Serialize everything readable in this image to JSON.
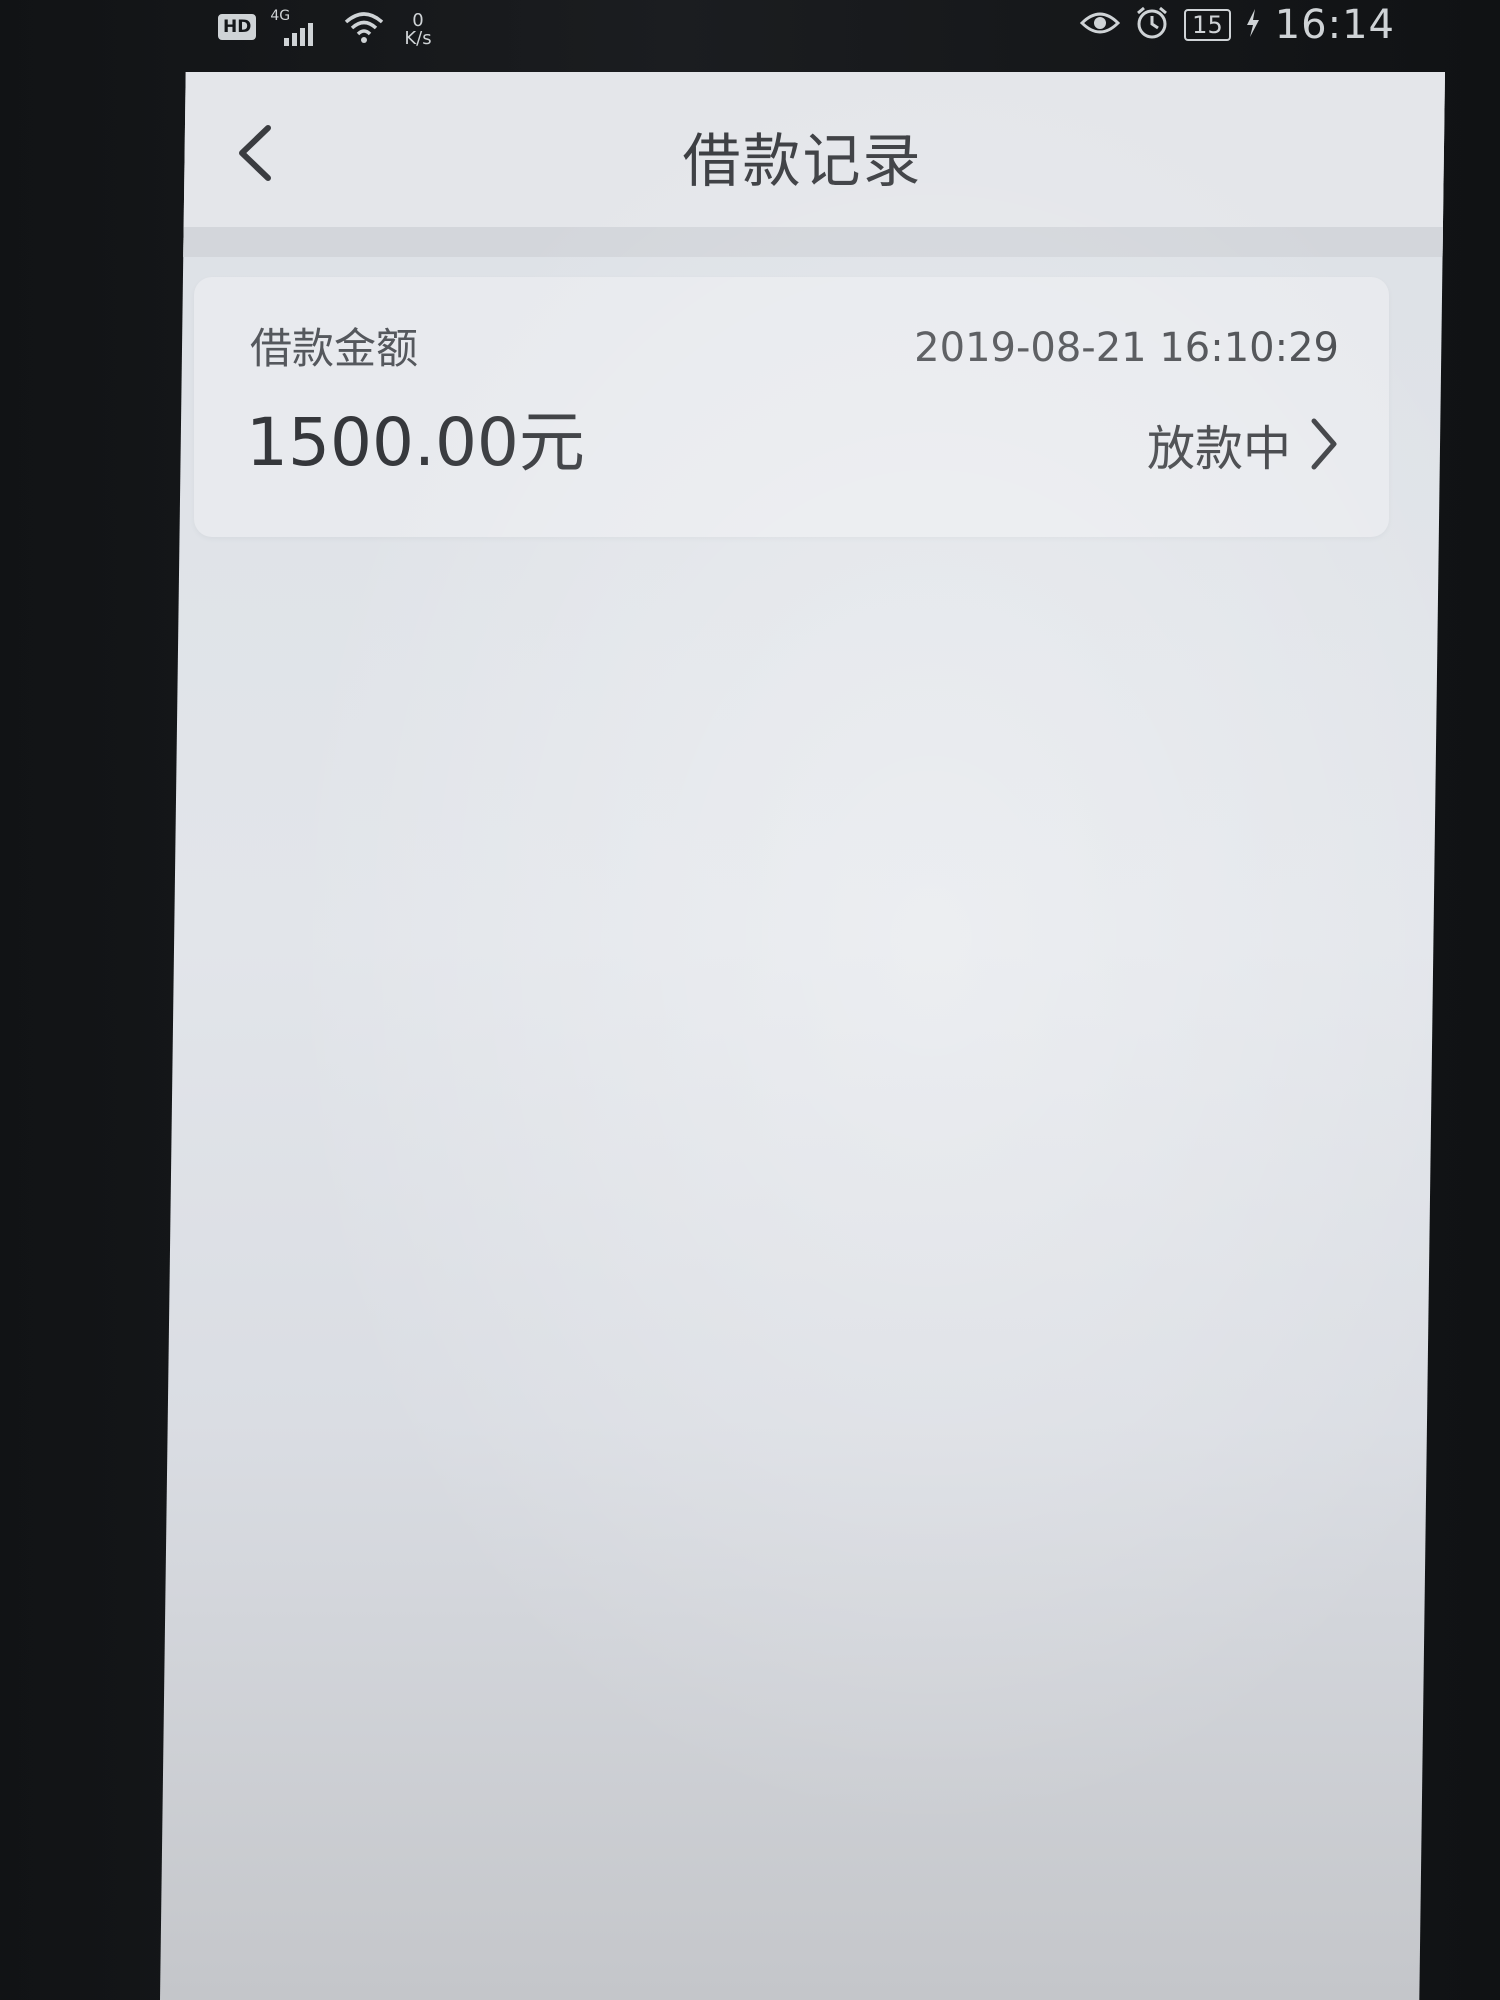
{
  "status_bar": {
    "hd_label": "HD",
    "network_generation": "4G",
    "speed_value": "0",
    "speed_unit": "K/s",
    "battery_level": "15",
    "time": "16:14",
    "icons": [
      "hd-icon",
      "cellular-signal-icon",
      "wifi-icon",
      "eye-comfort-icon",
      "alarm-icon",
      "battery-icon",
      "charging-icon"
    ]
  },
  "header": {
    "title": "借款记录",
    "back_icon": "chevron-left-icon"
  },
  "records": [
    {
      "amount_label": "借款金额",
      "amount": "1500.00元",
      "datetime": "2019-08-21 16:10:29",
      "status": "放款中",
      "arrow_icon": "chevron-right-icon"
    }
  ],
  "colors": {
    "background": "#e2e5ea",
    "card": "#e8eaee",
    "text_primary": "#35373b",
    "text_secondary": "#55585d"
  }
}
